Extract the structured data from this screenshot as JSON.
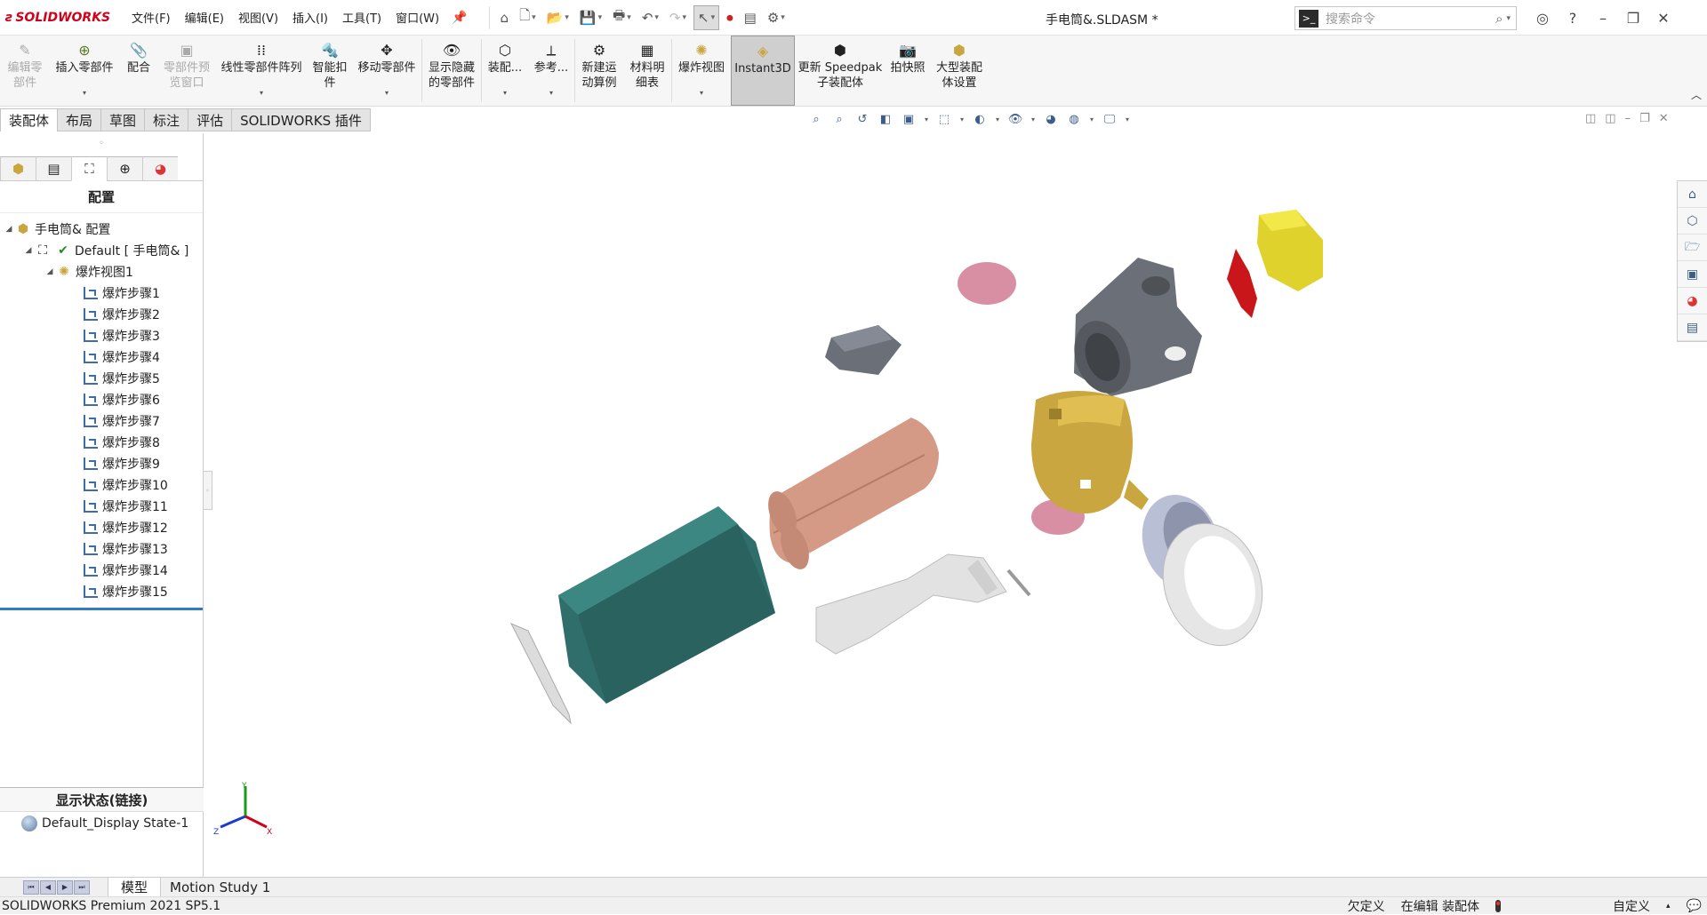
{
  "app": {
    "brand": "SOLIDWORKS",
    "doc_title": "手电筒&.SLDASM *",
    "menus": [
      "文件(F)",
      "编辑(E)",
      "视图(V)",
      "插入(I)",
      "工具(T)",
      "窗口(W)"
    ],
    "search_placeholder": "搜索命令"
  },
  "commands": [
    {
      "label": "编辑零部件",
      "l1": "编辑零",
      "l2": "部件",
      "disabled": true
    },
    {
      "label": "插入零部件",
      "l1": "插入零部件",
      "l2": "",
      "dropdown": true
    },
    {
      "label": "配合",
      "l1": "配合",
      "l2": ""
    },
    {
      "label": "零部件预览窗口",
      "l1": "零部件预",
      "l2": "览窗口",
      "disabled": true
    },
    {
      "label": "线性零部件阵列",
      "l1": "线性零部件阵列",
      "l2": "",
      "dropdown": true
    },
    {
      "label": "智能扣件",
      "l1": "智能扣",
      "l2": "件"
    },
    {
      "label": "移动零部件",
      "l1": "移动零部件",
      "l2": "",
      "dropdown": true
    },
    {
      "label": "显示隐藏的零部件",
      "l1": "显示隐藏",
      "l2": "的零部件"
    },
    {
      "label": "装配...",
      "l1": "装配...",
      "l2": "",
      "dropdown": true
    },
    {
      "label": "参考...",
      "l1": "参考...",
      "l2": "",
      "dropdown": true
    },
    {
      "label": "新建运动算例",
      "l1": "新建运",
      "l2": "动算例"
    },
    {
      "label": "材料明细表",
      "l1": "材料明",
      "l2": "细表"
    },
    {
      "label": "爆炸视图",
      "l1": "爆炸视图",
      "l2": "",
      "dropdown": true
    },
    {
      "label": "Instant3D",
      "l1": "Instant3D",
      "l2": "",
      "active": true
    },
    {
      "label": "更新 Speedpak 子装配体",
      "l1": "更新 Speedpak",
      "l2": "子装配体"
    },
    {
      "label": "拍快照",
      "l1": "拍快照",
      "l2": ""
    },
    {
      "label": "大型装配体设置",
      "l1": "大型装配",
      "l2": "体设置"
    }
  ],
  "tabs": [
    "装配体",
    "布局",
    "草图",
    "标注",
    "评估",
    "SOLIDWORKS 插件"
  ],
  "panel": {
    "title": "配置",
    "root": "手电筒& 配置",
    "config": "Default [ 手电筒& ]",
    "explode_view": "爆炸视图1",
    "steps": [
      "爆炸步骤1",
      "爆炸步骤2",
      "爆炸步骤3",
      "爆炸步骤4",
      "爆炸步骤5",
      "爆炸步骤6",
      "爆炸步骤7",
      "爆炸步骤8",
      "爆炸步骤9",
      "爆炸步骤10",
      "爆炸步骤11",
      "爆炸步骤12",
      "爆炸步骤13",
      "爆炸步骤14",
      "爆炸步骤15"
    ],
    "display_state_header": "显示状态(链接)",
    "display_state": "Default_Display State-1"
  },
  "triad": {
    "x": "X",
    "y": "Y",
    "z": "Z"
  },
  "bottom_tabs": [
    "模型",
    "Motion Study 1"
  ],
  "status": {
    "product": "SOLIDWORKS Premium 2021 SP5.1",
    "underdefined": "欠定义",
    "editing": "在编辑 装配体",
    "units": "自定义"
  },
  "colors": {
    "housing": "#2f6e6b",
    "batteries": "#d49a86",
    "head": "#c9a640",
    "bracket": "#6b6f78",
    "accent": "#d0021b"
  }
}
